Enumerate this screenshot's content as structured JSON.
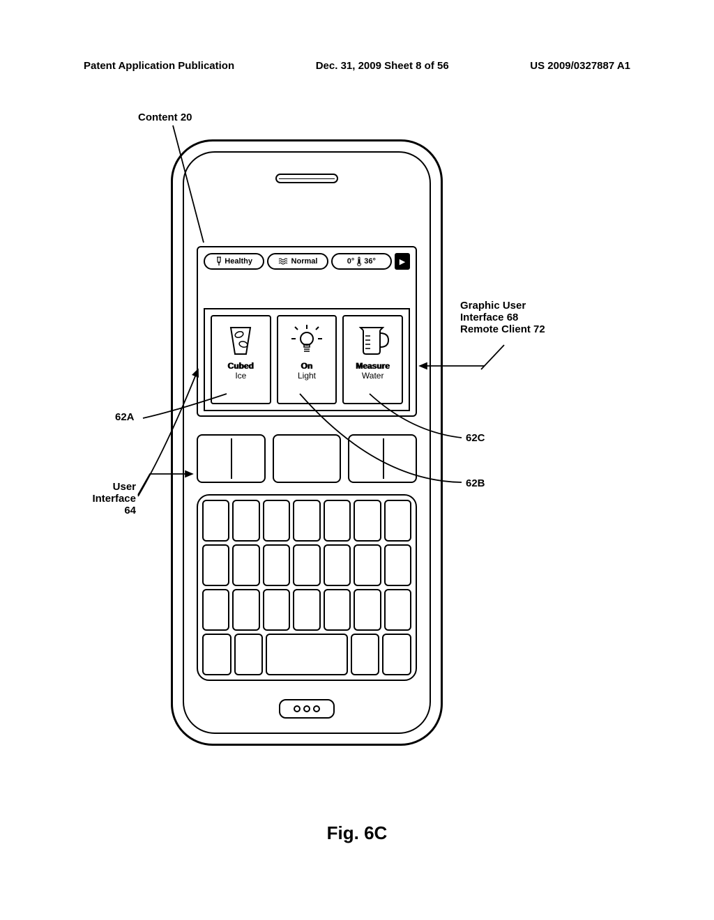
{
  "header": {
    "left": "Patent Application Publication",
    "center": "Dec. 31, 2009  Sheet 8 of 56",
    "right": "US 2009/0327887 A1"
  },
  "figure_caption": "Fig. 6C",
  "annotations": {
    "content": "Content  20",
    "gui_line1": "Graphic User",
    "gui_line2": "Interface 68",
    "gui_line3": "Remote Client 72",
    "ui_line1": "User",
    "ui_line2": "Interface",
    "ui_line3": "64",
    "ref_62A": "62A",
    "ref_62B": "62B",
    "ref_62C": "62C"
  },
  "screen": {
    "status": {
      "pill1": "Healthy",
      "pill2": "Normal",
      "pill3_left": "0°",
      "pill3_right": "36°",
      "next": "▶"
    },
    "options": [
      {
        "title": "Cubed",
        "sub": "Ice"
      },
      {
        "title": "On",
        "sub": "Light"
      },
      {
        "title": "Measure",
        "sub": "Water"
      }
    ]
  }
}
